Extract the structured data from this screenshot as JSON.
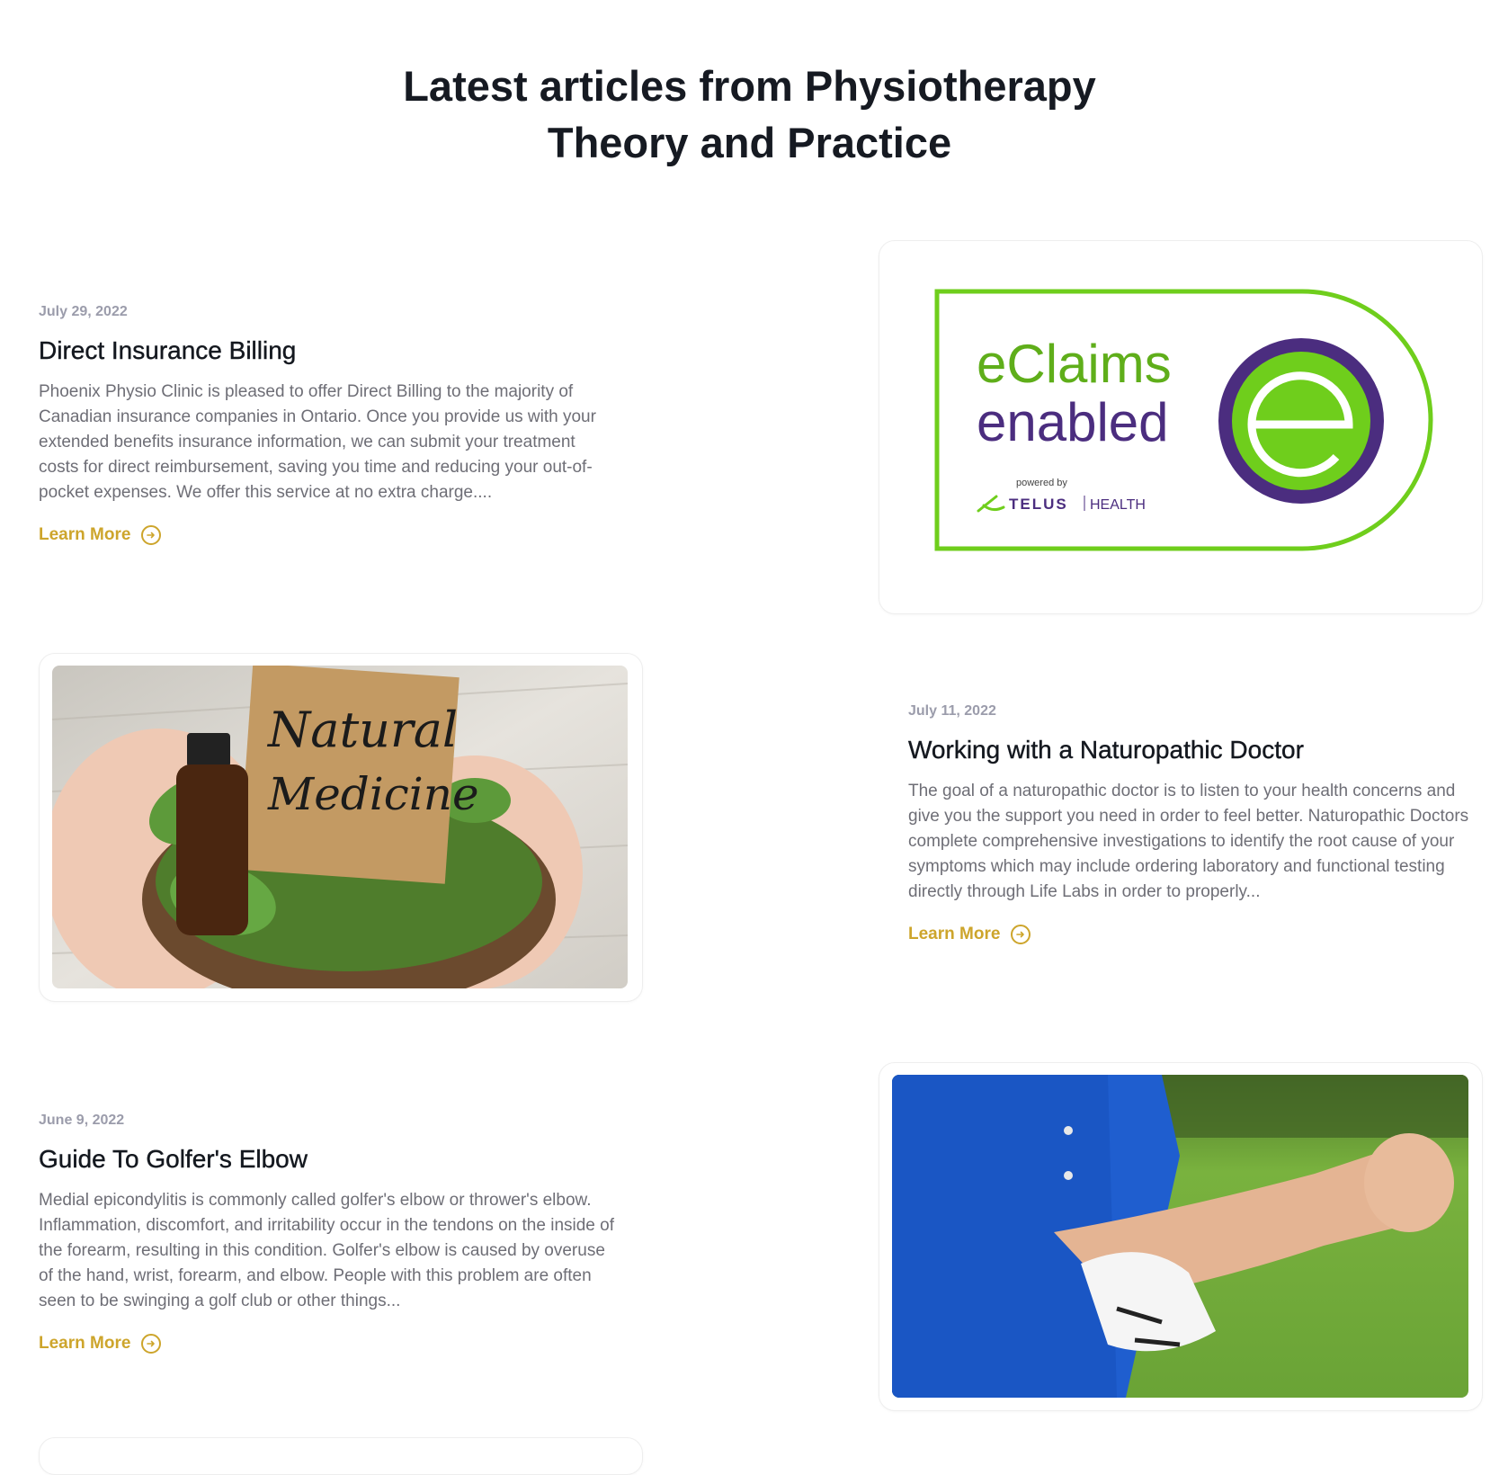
{
  "section": {
    "title_line1": "Latest articles from Physiotherapy",
    "title_line2": "Theory and Practice"
  },
  "posts": [
    {
      "date": "July 29, 2022",
      "title": "Direct Insurance Billing",
      "excerpt": "Phoenix Physio Clinic is pleased to offer Direct Billing to the majority of Canadian insurance companies in Ontario. Once you provide us with your extended benefits insurance information, we can submit your treatment costs for direct reimbursement, saving you time and reducing your out-of-pocket expenses. We offer this service at no extra charge....",
      "link_label": "Learn More",
      "image": {
        "line1": "eClaims",
        "line2": "enabled",
        "powered_by": "powered by",
        "brand": "TELUS",
        "brand_suffix": "HEALTH"
      }
    },
    {
      "date": "July 11, 2022",
      "title": "Working with a Naturopathic Doctor",
      "excerpt": "The goal of a naturopathic doctor is to listen to your health concerns and give you the support you need in order to feel better. Naturopathic Doctors complete comprehensive investigations to identify the root cause of your symptoms which may include ordering laboratory and functional testing directly through Life Labs in order to properly...",
      "link_label": "Learn More",
      "image": {
        "sign_line1": "Natural",
        "sign_line2": "Medicine"
      }
    },
    {
      "date": "June 9, 2022",
      "title": "Guide To Golfer's Elbow",
      "excerpt": "Medial epicondylitis is commonly called golfer's elbow or thrower's elbow. Inflammation, discomfort, and irritability occur in the tendons on the inside of the forearm, resulting in this condition. Golfer's elbow is caused by overuse of the hand, wrist, forearm, and elbow. People with this problem are often seen to be swinging a golf club or other things...",
      "link_label": "Learn More"
    }
  ],
  "colors": {
    "accent": "#cda52c",
    "date": "#9b9cab",
    "excerpt": "#6e6e76",
    "heading": "#161a22",
    "eclaims_green": "#6fce1c",
    "eclaims_purple": "#4b2d7f"
  }
}
